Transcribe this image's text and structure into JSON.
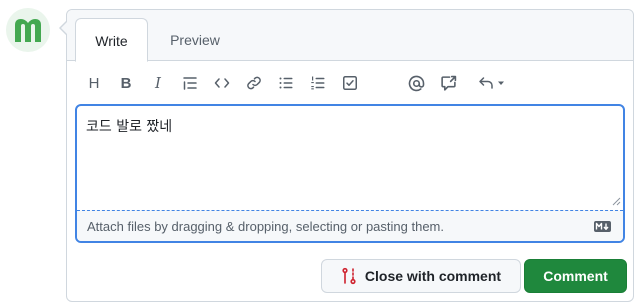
{
  "avatar": {
    "icon": "m-logo-icon",
    "color": "#43a850"
  },
  "tabs": [
    {
      "label": "Write",
      "active": true
    },
    {
      "label": "Preview",
      "active": false
    }
  ],
  "toolbar": {
    "heading": "H",
    "bold": "B",
    "italic": "I",
    "icons": [
      "heading-icon",
      "bold-icon",
      "italic-icon",
      "quote-icon",
      "code-icon",
      "link-icon",
      "bulleted-list-icon",
      "numbered-list-icon",
      "task-list-icon",
      "mention-icon",
      "reference-icon",
      "undo-icon"
    ]
  },
  "editor": {
    "value": "코드 발로 짰네",
    "attach_text": "Attach files by dragging & dropping, selecting or pasting them.",
    "markdown_icon": "markdown-icon"
  },
  "buttons": {
    "close_label": "Close with comment",
    "comment_label": "Comment"
  },
  "colors": {
    "accent": "#4184e4",
    "primary": "#1f883d",
    "close_icon": "#cf222e"
  }
}
